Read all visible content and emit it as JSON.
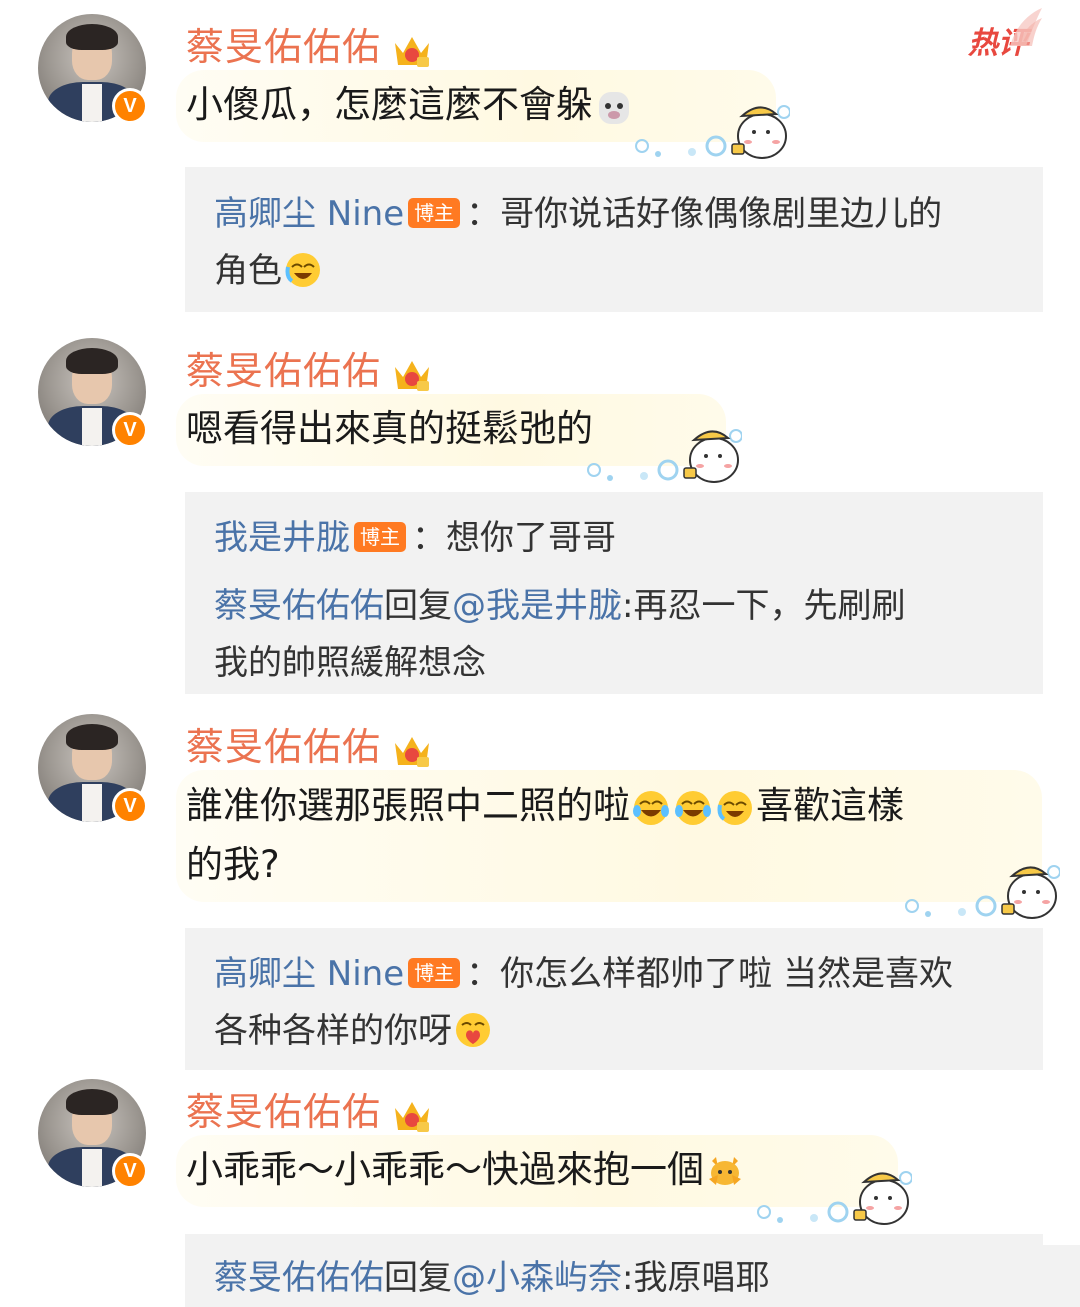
{
  "hot_label": "热评",
  "blogger_badge": "博主",
  "vip_badge": "V",
  "comments": [
    {
      "username": "蔡旻佑佑佑",
      "text_lines": [
        "小傻瓜，怎麼這麼不會躲"
      ],
      "text_emojis": [
        "alpaca-emoji"
      ],
      "replies": [
        {
          "name": "高卿尘 Nine",
          "is_blogger": true,
          "lines": [
            "：哥你说话好像偶像剧里边儿的",
            "角色"
          ],
          "emojis": [
            "laugh-cry-emoji"
          ]
        }
      ]
    },
    {
      "username": "蔡旻佑佑佑",
      "text_lines": [
        "嗯看得出來真的挺鬆弛的"
      ],
      "replies": [
        {
          "name": "我是井胧",
          "is_blogger": true,
          "lines": [
            "：想你了哥哥"
          ]
        },
        {
          "name": "蔡旻佑佑佑",
          "reply_word": "回复",
          "mention": "@我是井胧",
          "lines": [
            ":再忍一下，先刷刷",
            "我的帥照緩解想念"
          ]
        }
      ]
    },
    {
      "username": "蔡旻佑佑佑",
      "text_lines": [
        "誰准你選那張照中二照的啦",
        "喜歡這樣",
        "的我?"
      ],
      "text_emojis": [
        "tears-of-joy-emoji",
        "tears-of-joy-emoji",
        "laugh-cry-emoji"
      ],
      "replies": [
        {
          "name": "高卿尘 Nine",
          "is_blogger": true,
          "lines": [
            "：你怎么样都帅了啦 当然是喜欢",
            "各种各样的你呀"
          ],
          "emojis": [
            "heart-kiss-emoji"
          ]
        }
      ]
    },
    {
      "username": "蔡旻佑佑佑",
      "text_lines": [
        "小乖乖～小乖乖～快過來抱一個"
      ],
      "text_emojis": [
        "hug-emoji"
      ],
      "replies": [
        {
          "name": "蔡旻佑佑佑",
          "reply_word": "回复",
          "mention": "@小森屿奈",
          "lines": [
            ":我原唱耶"
          ]
        }
      ]
    }
  ],
  "colors": {
    "username": "#eb7350",
    "reply_name": "#4a73a8",
    "reply_bg": "#f2f2f2",
    "blogger_badge": "#ff7a22",
    "hot_label": "#e8483f",
    "vip": "#ff8200"
  }
}
